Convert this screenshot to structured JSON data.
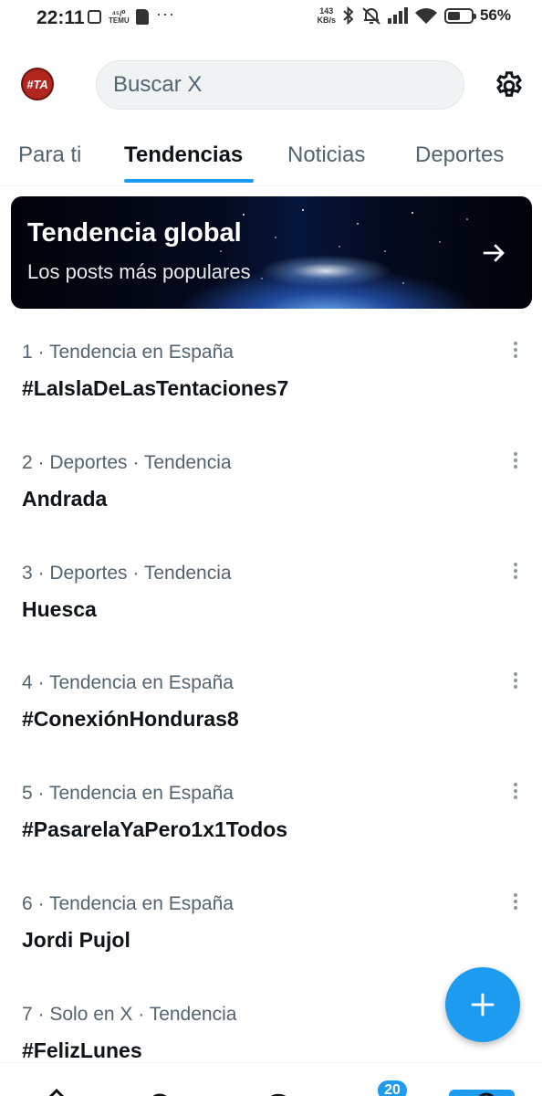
{
  "status_bar": {
    "time": "22:11",
    "temu_label": "TEMU",
    "net_speed_value": "143",
    "net_speed_unit": "KB/s",
    "battery_percent": "56%",
    "battery_level": 0.56
  },
  "header": {
    "avatar_text": "#TA",
    "search_placeholder": "Buscar X",
    "settings_icon": "gear-icon"
  },
  "tabs": [
    {
      "label": "Para ti",
      "active": false
    },
    {
      "label": "Tendencias",
      "active": true
    },
    {
      "label": "Noticias",
      "active": false
    },
    {
      "label": "Deportes",
      "active": false
    }
  ],
  "banner": {
    "title": "Tendencia global",
    "subtitle": "Los posts más populares",
    "arrow_icon": "arrow-right-icon"
  },
  "trends": [
    {
      "meta": "1 · Tendencia en España",
      "name": "#LaIslaDeLasTentaciones7"
    },
    {
      "meta": "2 · Deportes · Tendencia",
      "name": "Andrada"
    },
    {
      "meta": "3 · Deportes · Tendencia",
      "name": "Huesca"
    },
    {
      "meta": "4 · Tendencia en España",
      "name": "#ConexiónHonduras8"
    },
    {
      "meta": "5 · Tendencia en España",
      "name": "#PasarelaYaPero1x1Todos"
    },
    {
      "meta": "6 · Tendencia en España",
      "name": "Jordi Pujol"
    },
    {
      "meta": "7 · Solo en X · Tendencia",
      "name": "#FelizLunes"
    }
  ],
  "bottom_nav": {
    "notifications_badge": "20",
    "accent_color": "#1d9bf0"
  }
}
